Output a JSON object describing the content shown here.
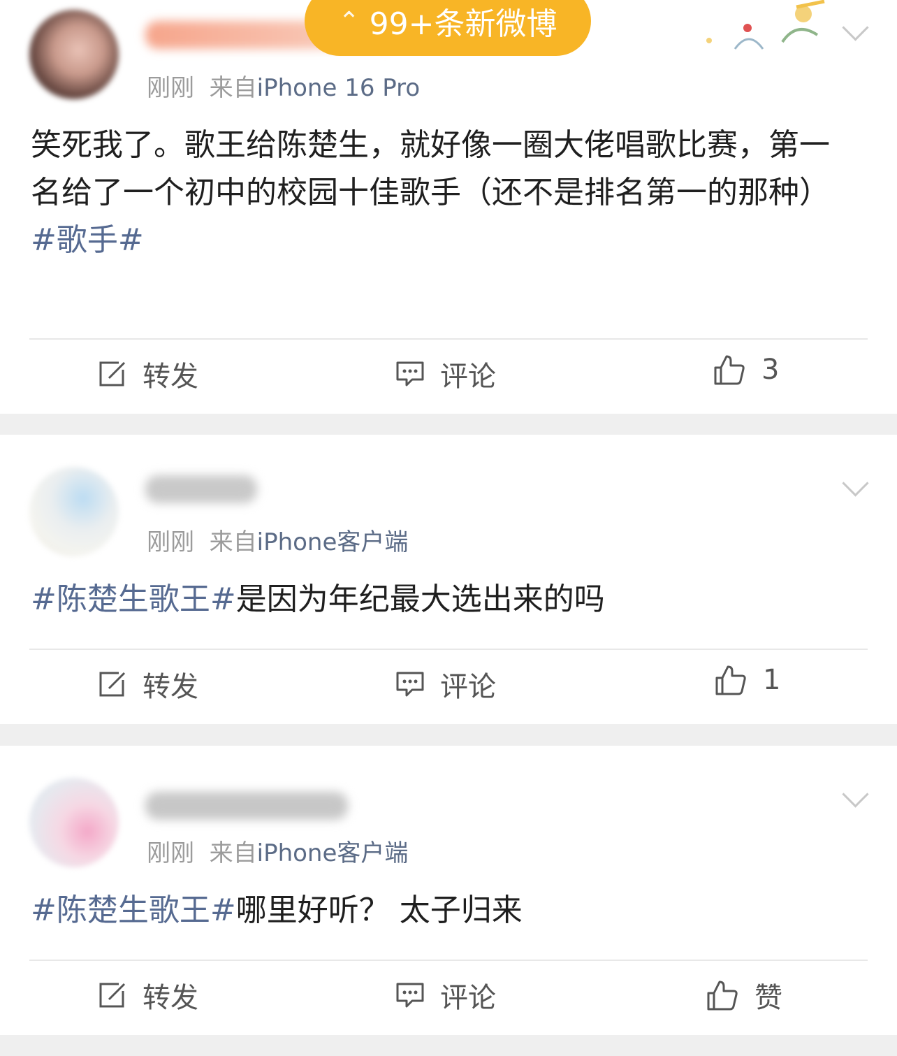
{
  "banner": {
    "new_posts_label": "99+条新微博"
  },
  "posts": [
    {
      "time": "刚刚",
      "from_prefix": "来自",
      "source": "iPhone 16 Pro",
      "text_body": "笑死我了。歌王给陈楚生，就好像一圈大佬唱歌比赛，第一名给了一个初中的校园十佳歌手（还不是排名第一的那种）",
      "hashtag": "#歌手#",
      "actions": {
        "repost": "转发",
        "comment": "评论",
        "like": "3"
      }
    },
    {
      "time": "刚刚",
      "from_prefix": "来自",
      "source": "iPhone客户端",
      "hashtag": "#陈楚生歌王#",
      "text_body": "是因为年纪最大选出来的吗",
      "actions": {
        "repost": "转发",
        "comment": "评论",
        "like": "1"
      }
    },
    {
      "time": "刚刚",
      "from_prefix": "来自",
      "source": "iPhone客户端",
      "hashtag": "#陈楚生歌王#",
      "text_body": "哪里好听？ 太子归来",
      "actions": {
        "repost": "转发",
        "comment": "评论",
        "like": "赞"
      }
    }
  ],
  "colors": {
    "banner": "#f8b526",
    "topic_link": "#566a91",
    "meta": "#9b9b9b",
    "feed_gap": "#efefef"
  }
}
